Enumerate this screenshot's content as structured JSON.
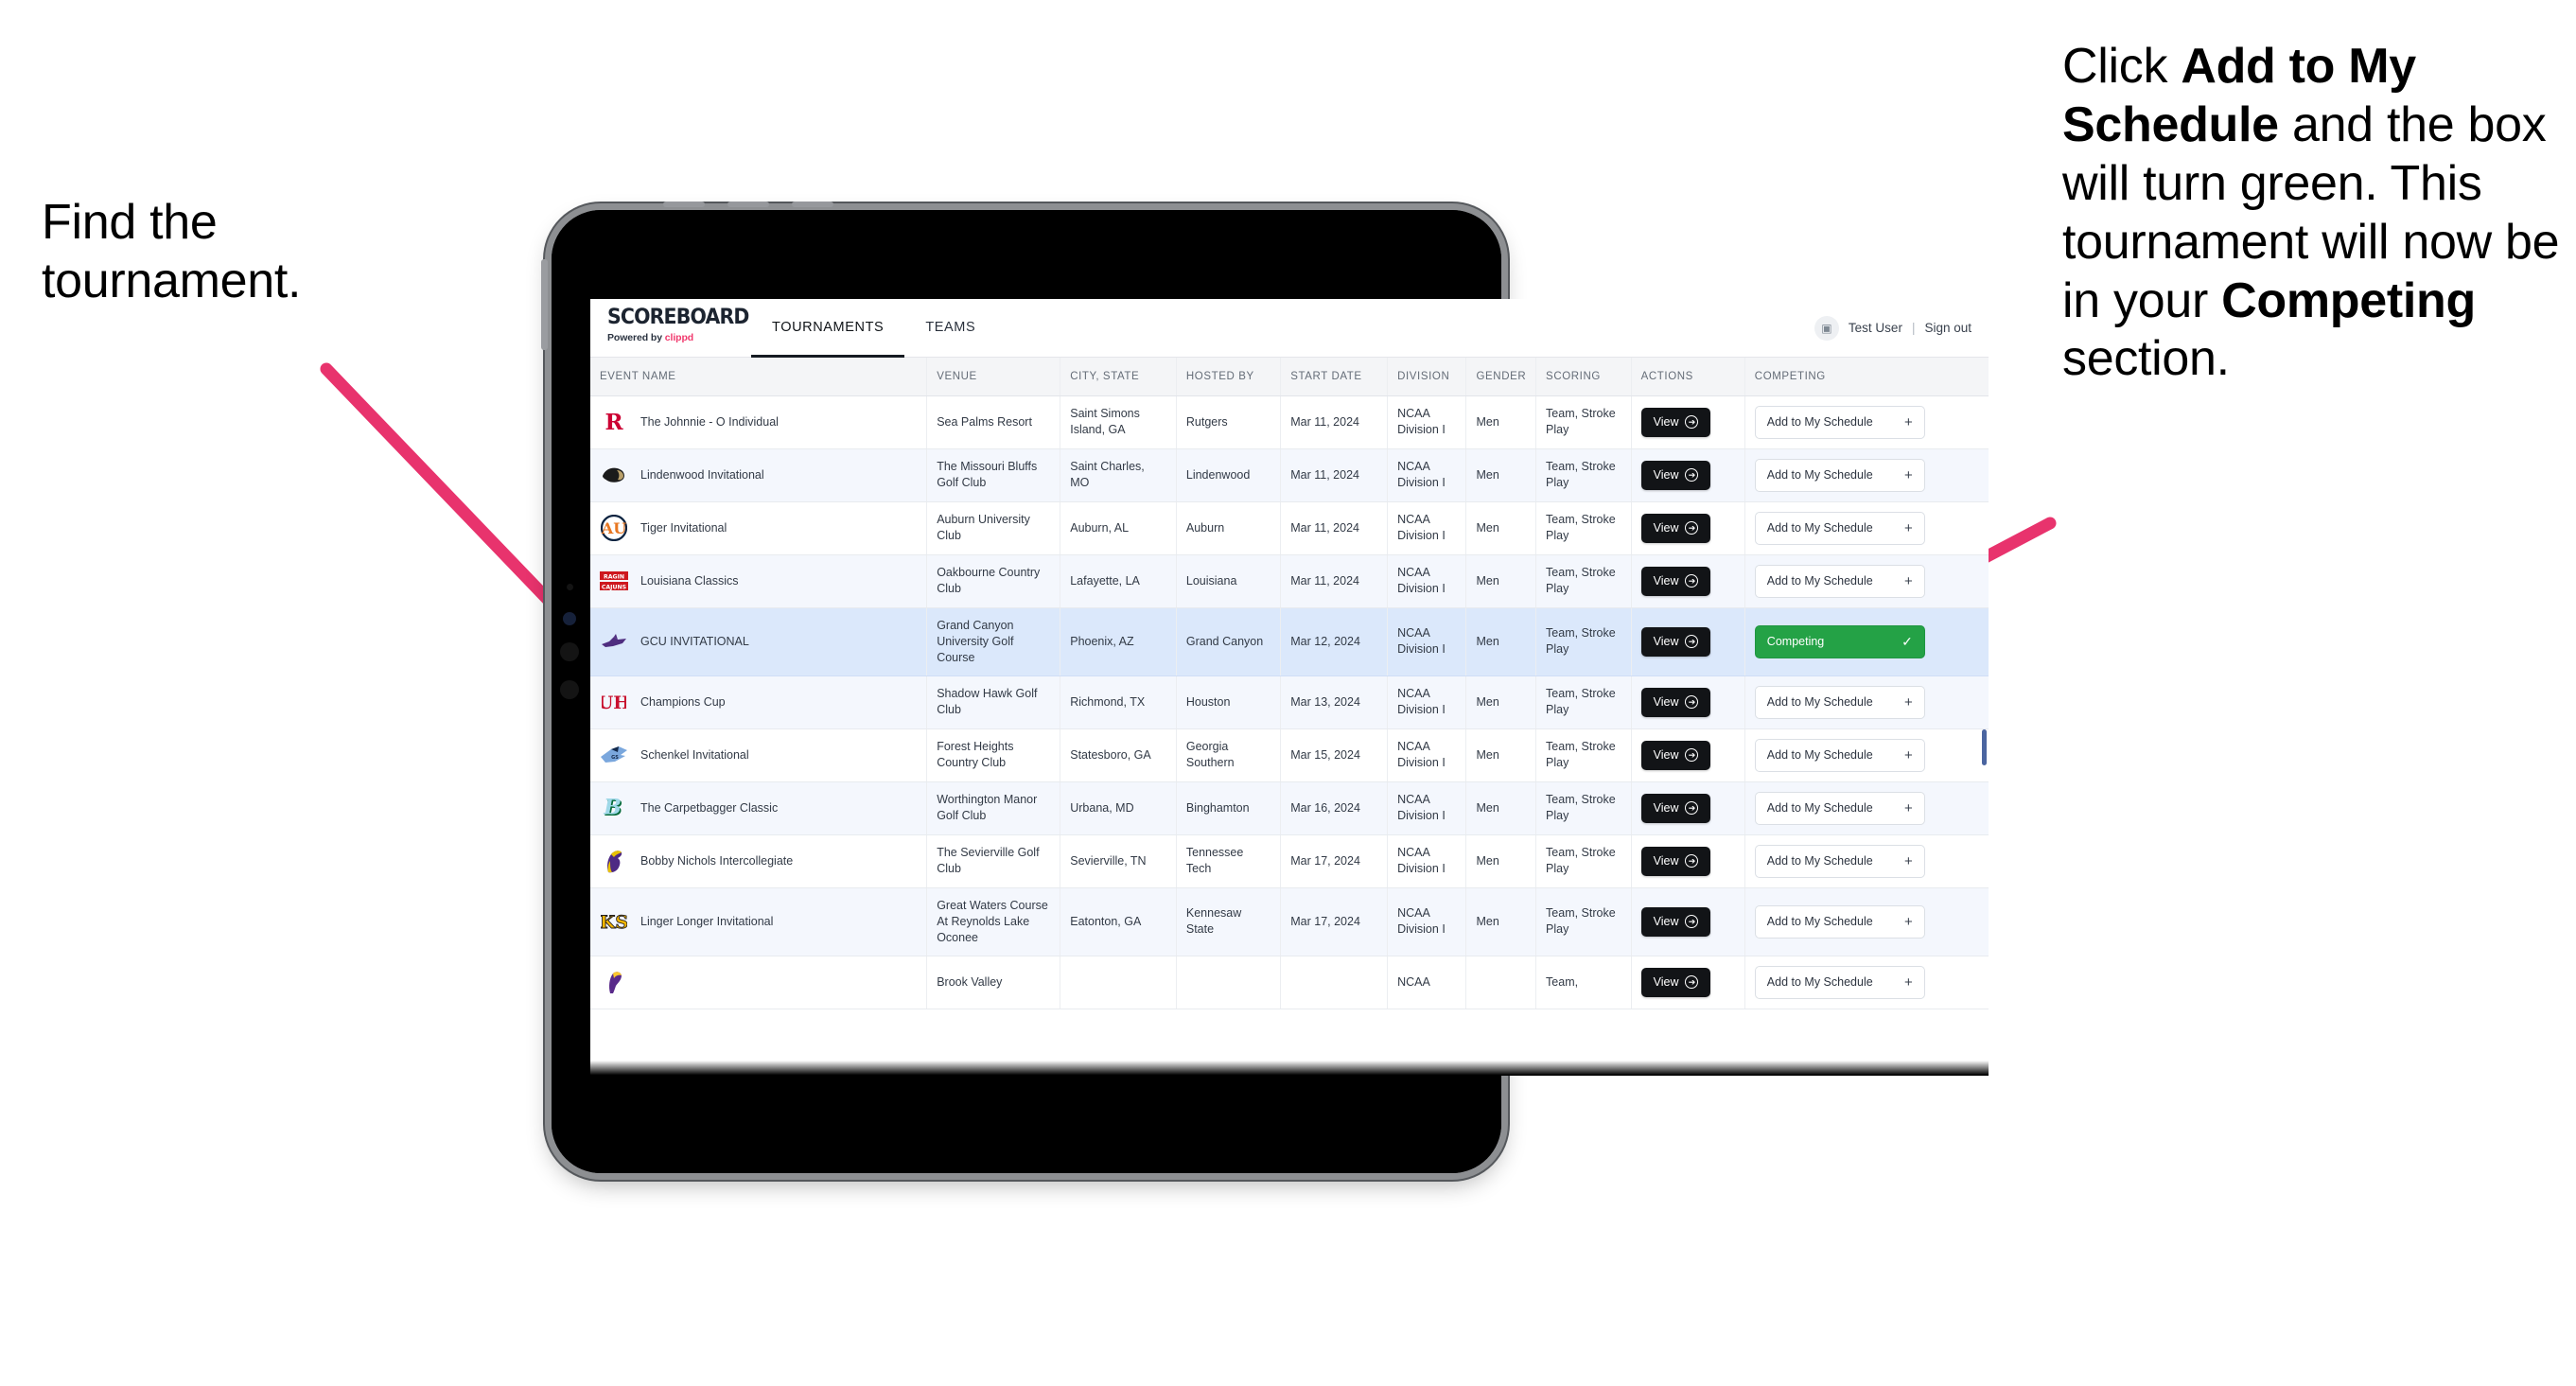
{
  "annotations": {
    "left": {
      "line1": "Find the",
      "line2": "tournament."
    },
    "right": {
      "p1_pre": "Click ",
      "p1_bold": "Add to My Schedule",
      "p1_post": " and the box will turn green. This tournament will now be in your ",
      "p2_bold": "Competing",
      "p2_post": " section."
    },
    "arrow_color": "#E8336D"
  },
  "app": {
    "brand": {
      "title": "SCOREBOARD",
      "powered_prefix": "Powered by ",
      "powered_brand": "clippd"
    },
    "tabs": [
      {
        "label": "TOURNAMENTS",
        "active": true
      },
      {
        "label": "TEAMS",
        "active": false
      }
    ],
    "user": {
      "name": "Test User",
      "separator": "|",
      "signout": "Sign out",
      "avatar_glyph": "▣"
    },
    "table": {
      "columns": [
        "EVENT NAME",
        "VENUE",
        "CITY, STATE",
        "HOSTED BY",
        "START DATE",
        "DIVISION",
        "GENDER",
        "SCORING",
        "ACTIONS",
        "COMPETING"
      ],
      "action_label": "View",
      "add_label": "Add to My Schedule",
      "add_glyph": "+",
      "competing_label": "Competing",
      "competing_glyph": "✓",
      "rows": [
        {
          "event": "The Johnnie - O Individual",
          "venue": "Sea Palms Resort",
          "city": "Saint Simons Island, GA",
          "host": "Rutgers",
          "date": "Mar 11, 2024",
          "division": "NCAA Division I",
          "gender": "Men",
          "scoring": "Team, Stroke Play",
          "competing": false,
          "logo": "rutgers-r-logo"
        },
        {
          "event": "Lindenwood Invitational",
          "venue": "The Missouri Bluffs Golf Club",
          "city": "Saint Charles, MO",
          "host": "Lindenwood",
          "date": "Mar 11, 2024",
          "division": "NCAA Division I",
          "gender": "Men",
          "scoring": "Team, Stroke Play",
          "competing": false,
          "logo": "lindenwood-lion-logo"
        },
        {
          "event": "Tiger Invitational",
          "venue": "Auburn University Club",
          "city": "Auburn, AL",
          "host": "Auburn",
          "date": "Mar 11, 2024",
          "division": "NCAA Division I",
          "gender": "Men",
          "scoring": "Team, Stroke Play",
          "competing": false,
          "logo": "auburn-au-logo"
        },
        {
          "event": "Louisiana Classics",
          "venue": "Oakbourne Country Club",
          "city": "Lafayette, LA",
          "host": "Louisiana",
          "date": "Mar 11, 2024",
          "division": "NCAA Division I",
          "gender": "Men",
          "scoring": "Team, Stroke Play",
          "competing": false,
          "logo": "ragin-cajuns-logo"
        },
        {
          "event": "GCU INVITATIONAL",
          "venue": "Grand Canyon University Golf Course",
          "city": "Phoenix, AZ",
          "host": "Grand Canyon",
          "date": "Mar 12, 2024",
          "division": "NCAA Division I",
          "gender": "Men",
          "scoring": "Team, Stroke Play",
          "competing": true,
          "logo": "grand-canyon-lope-logo"
        },
        {
          "event": "Champions Cup",
          "venue": "Shadow Hawk Golf Club",
          "city": "Richmond, TX",
          "host": "Houston",
          "date": "Mar 13, 2024",
          "division": "NCAA Division I",
          "gender": "Men",
          "scoring": "Team, Stroke Play",
          "competing": false,
          "logo": "houston-uh-logo"
        },
        {
          "event": "Schenkel Invitational",
          "venue": "Forest Heights Country Club",
          "city": "Statesboro, GA",
          "host": "Georgia Southern",
          "date": "Mar 15, 2024",
          "division": "NCAA Division I",
          "gender": "Men",
          "scoring": "Team, Stroke Play",
          "competing": false,
          "logo": "georgia-southern-eagle-logo"
        },
        {
          "event": "The Carpetbagger Classic",
          "venue": "Worthington Manor Golf Club",
          "city": "Urbana, MD",
          "host": "Binghamton",
          "date": "Mar 16, 2024",
          "division": "NCAA Division I",
          "gender": "Men",
          "scoring": "Team, Stroke Play",
          "competing": false,
          "logo": "binghamton-b-logo"
        },
        {
          "event": "Bobby Nichols Intercollegiate",
          "venue": "The Sevierville Golf Club",
          "city": "Sevierville, TN",
          "host": "Tennessee Tech",
          "date": "Mar 17, 2024",
          "division": "NCAA Division I",
          "gender": "Men",
          "scoring": "Team, Stroke Play",
          "competing": false,
          "logo": "tennessee-tech-eagle-logo"
        },
        {
          "event": "Linger Longer Invitational",
          "venue": "Great Waters Course At Reynolds Lake Oconee",
          "city": "Eatonton, GA",
          "host": "Kennesaw State",
          "date": "Mar 17, 2024",
          "division": "NCAA Division I",
          "gender": "Men",
          "scoring": "Team, Stroke Play",
          "competing": false,
          "logo": "kennesaw-state-ks-logo"
        },
        {
          "event": "",
          "venue": "Brook Valley",
          "city": "",
          "host": "",
          "date": "",
          "division": "NCAA",
          "gender": "",
          "scoring": "Team,",
          "competing": false,
          "logo": "east-carolina-logo",
          "partial": true
        }
      ]
    }
  }
}
